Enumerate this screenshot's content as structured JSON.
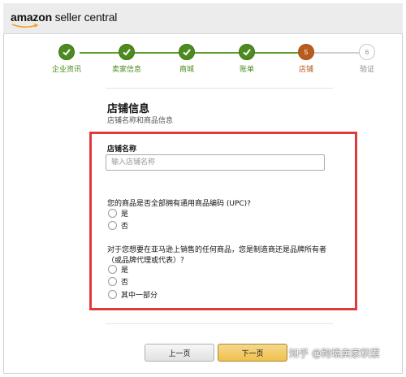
{
  "header": {
    "logo_bold": "amazon",
    "logo_rest": " seller central"
  },
  "steps": [
    {
      "label": "企业资讯",
      "state": "done"
    },
    {
      "label": "卖家信息",
      "state": "done"
    },
    {
      "label": "商城",
      "state": "done"
    },
    {
      "label": "账单",
      "state": "done"
    },
    {
      "label": "店铺",
      "state": "current",
      "number": "5"
    },
    {
      "label": "验证",
      "state": "todo",
      "number": "6"
    }
  ],
  "form": {
    "title": "店铺信息",
    "subtitle": "店铺名称和商品信息",
    "store_name_label": "店铺名称",
    "store_name_placeholder": "输入店铺名称",
    "store_name_value": "",
    "upc_question": "您的商品是否全部拥有通用商品编码 (UPC)?",
    "upc_options": [
      "是",
      "否"
    ],
    "brand_question_line1": "对于您想要在亚马逊上销售的任何商品，您是制造商还是品牌所有者",
    "brand_question_line2": "（或品牌代理或代表）？",
    "brand_options": [
      "是",
      "否",
      "其中一部分"
    ]
  },
  "buttons": {
    "prev": "上一页",
    "next": "下一页"
  },
  "watermark": "知乎 @跨境卖家积累",
  "colors": {
    "done": "#4d8a1f",
    "current": "#b85c1e",
    "highlight_box": "#e23a3a",
    "next_button": "#f0c14b"
  }
}
